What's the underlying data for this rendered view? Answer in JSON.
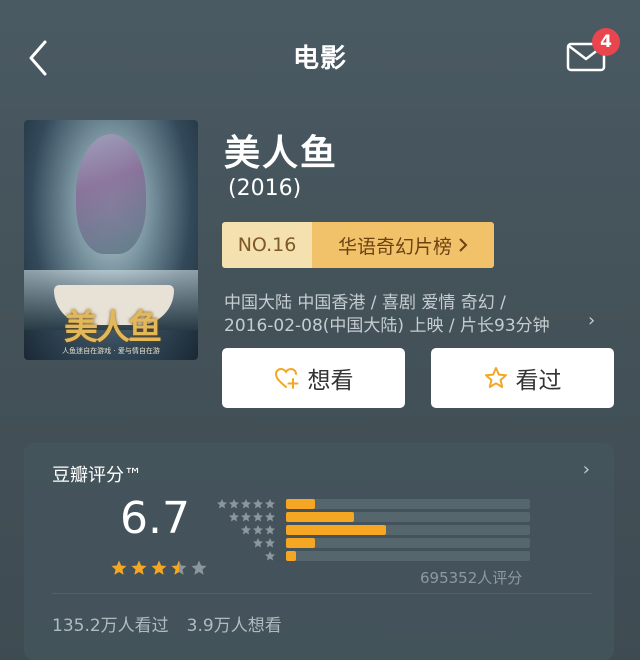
{
  "nav": {
    "title": "电影",
    "back_icon": "chevron-left-icon",
    "mail_icon": "envelope-icon",
    "mail_badge": "4"
  },
  "movie": {
    "poster_title": "美人鱼",
    "poster_subtitle": "人鱼迷自在游戏 · 爱与情自在游",
    "title": "美人鱼",
    "year": "(2016)",
    "rank_no": "NO.16",
    "rank_list": "华语奇幻片榜",
    "meta_line1": "中国大陆 中国香港 / 喜剧 爱情 奇幻 /",
    "meta_line2": "2016-02-08(中国大陆) 上映 / 片长93分钟"
  },
  "actions": {
    "want_label": "想看",
    "seen_label": "看过"
  },
  "rating": {
    "header": "豆瓣评分™",
    "score": "6.7",
    "stars_value": 3.5,
    "stars_max": 5,
    "distribution": [
      {
        "stars": 5,
        "fraction": 0.12
      },
      {
        "stars": 4,
        "fraction": 0.28
      },
      {
        "stars": 3,
        "fraction": 0.41
      },
      {
        "stars": 2,
        "fraction": 0.12
      },
      {
        "stars": 1,
        "fraction": 0.04
      }
    ],
    "count_text": "695352人评分",
    "seen_count": "135.2万人看过",
    "want_count": "3.9万人想看"
  },
  "colors": {
    "accent_star": "#f5a623",
    "badge": "#e9454e",
    "rank_pill_light": "#f5e0b0",
    "rank_pill_dark": "#f2c26a"
  }
}
